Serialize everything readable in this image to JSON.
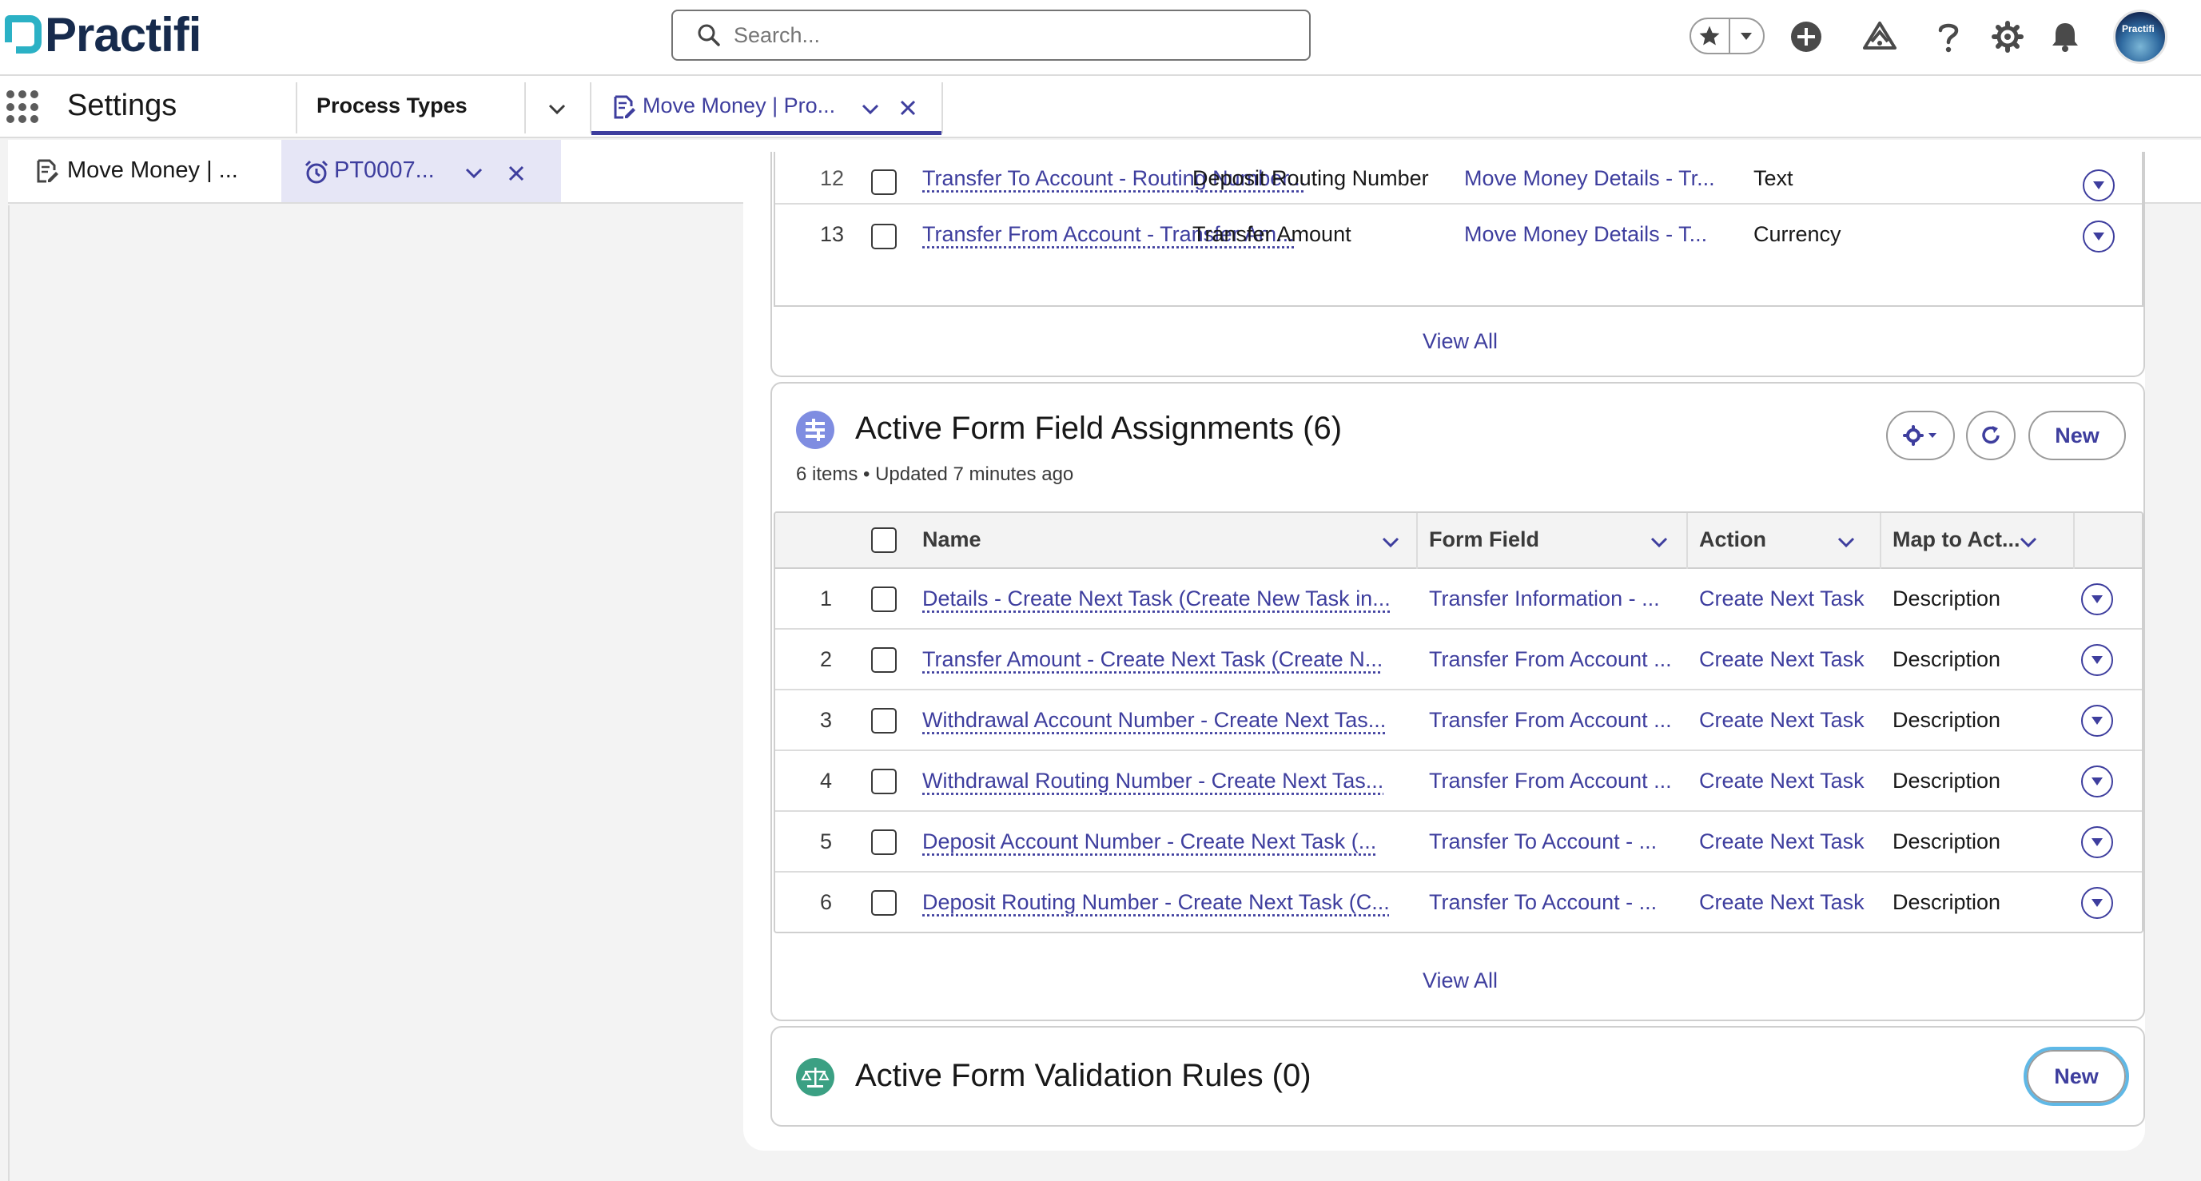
{
  "global_header": {
    "logo_text": "Practifi",
    "search": {
      "placeholder": "Search..."
    },
    "icons": [
      "favorites-star-icon",
      "add-icon",
      "trailhead-icon",
      "help-icon",
      "setup-gear-icon",
      "notifications-bell-icon",
      "avatar"
    ],
    "avatar_text": "Practifi"
  },
  "nav": {
    "app_name": "Settings",
    "items": [
      {
        "label": "Process Types"
      }
    ],
    "active_tab": {
      "label": "Move Money | Pro..."
    }
  },
  "subtabs": [
    {
      "label": "Move Money | ...",
      "active": false
    },
    {
      "label": "PT0007...",
      "active": true
    }
  ],
  "top_related_list": {
    "partial_row": {
      "num": "12",
      "name": "Transfer To Account - Routing Number...",
      "label": "Deposit Routing Number",
      "section": "Move Money Details - Tr...",
      "type": "Text"
    },
    "row_13": {
      "num": "13",
      "name": "Transfer From Account - Transfer Am...",
      "label": "Transfer Amount",
      "section": "Move Money Details - T...",
      "type": "Currency"
    },
    "view_all": "View All"
  },
  "assignments": {
    "title": "Active Form Field Assignments (6)",
    "meta": "6 items • Updated 7 minutes ago",
    "new_label": "New",
    "columns": [
      "Name",
      "Form Field",
      "Action",
      "Map to Act..."
    ],
    "rows": [
      {
        "num": "1",
        "name": "Details - Create Next Task (Create New Task in...",
        "form_field": "Transfer Information - ...",
        "action": "Create Next Task",
        "map": "Description"
      },
      {
        "num": "2",
        "name": "Transfer Amount - Create Next Task (Create N...",
        "form_field": "Transfer From Account ...",
        "action": "Create Next Task",
        "map": "Description"
      },
      {
        "num": "3",
        "name": "Withdrawal Account Number - Create Next Tas...",
        "form_field": "Transfer From Account ...",
        "action": "Create Next Task",
        "map": "Description"
      },
      {
        "num": "4",
        "name": "Withdrawal Routing Number - Create Next Tas...",
        "form_field": "Transfer From Account ...",
        "action": "Create Next Task",
        "map": "Description"
      },
      {
        "num": "5",
        "name": "Deposit Account Number - Create Next Task (...",
        "form_field": "Transfer To Account - ...",
        "action": "Create Next Task",
        "map": "Description"
      },
      {
        "num": "6",
        "name": "Deposit Routing Number - Create Next Task (C...",
        "form_field": "Transfer To Account - ...",
        "action": "Create Next Task",
        "map": "Description"
      }
    ],
    "view_all": "View All"
  },
  "validation": {
    "title": "Active Form Validation Rules (0)",
    "new_label": "New"
  },
  "colors": {
    "brand_link": "#3e3e9e",
    "logo_accent": "#2bb1c5",
    "assignments_icon": "#7f8de1",
    "validation_icon": "#3ba083"
  }
}
